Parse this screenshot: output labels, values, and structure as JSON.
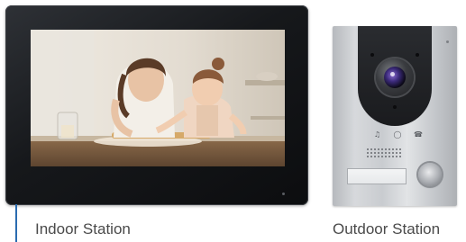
{
  "labels": {
    "indoor": "Indoor Station",
    "outdoor": "Outdoor Station"
  },
  "icons": {
    "outdoor_status": [
      "bell-icon",
      "key-icon",
      "phone-icon"
    ]
  },
  "colors": {
    "callout_line": "#2b6cb0",
    "label_text": "#4a4a4a",
    "monitor_bezel": "#16181b",
    "door_panel": "#1a1b1e",
    "lens_accent": "#8a6cd0"
  }
}
